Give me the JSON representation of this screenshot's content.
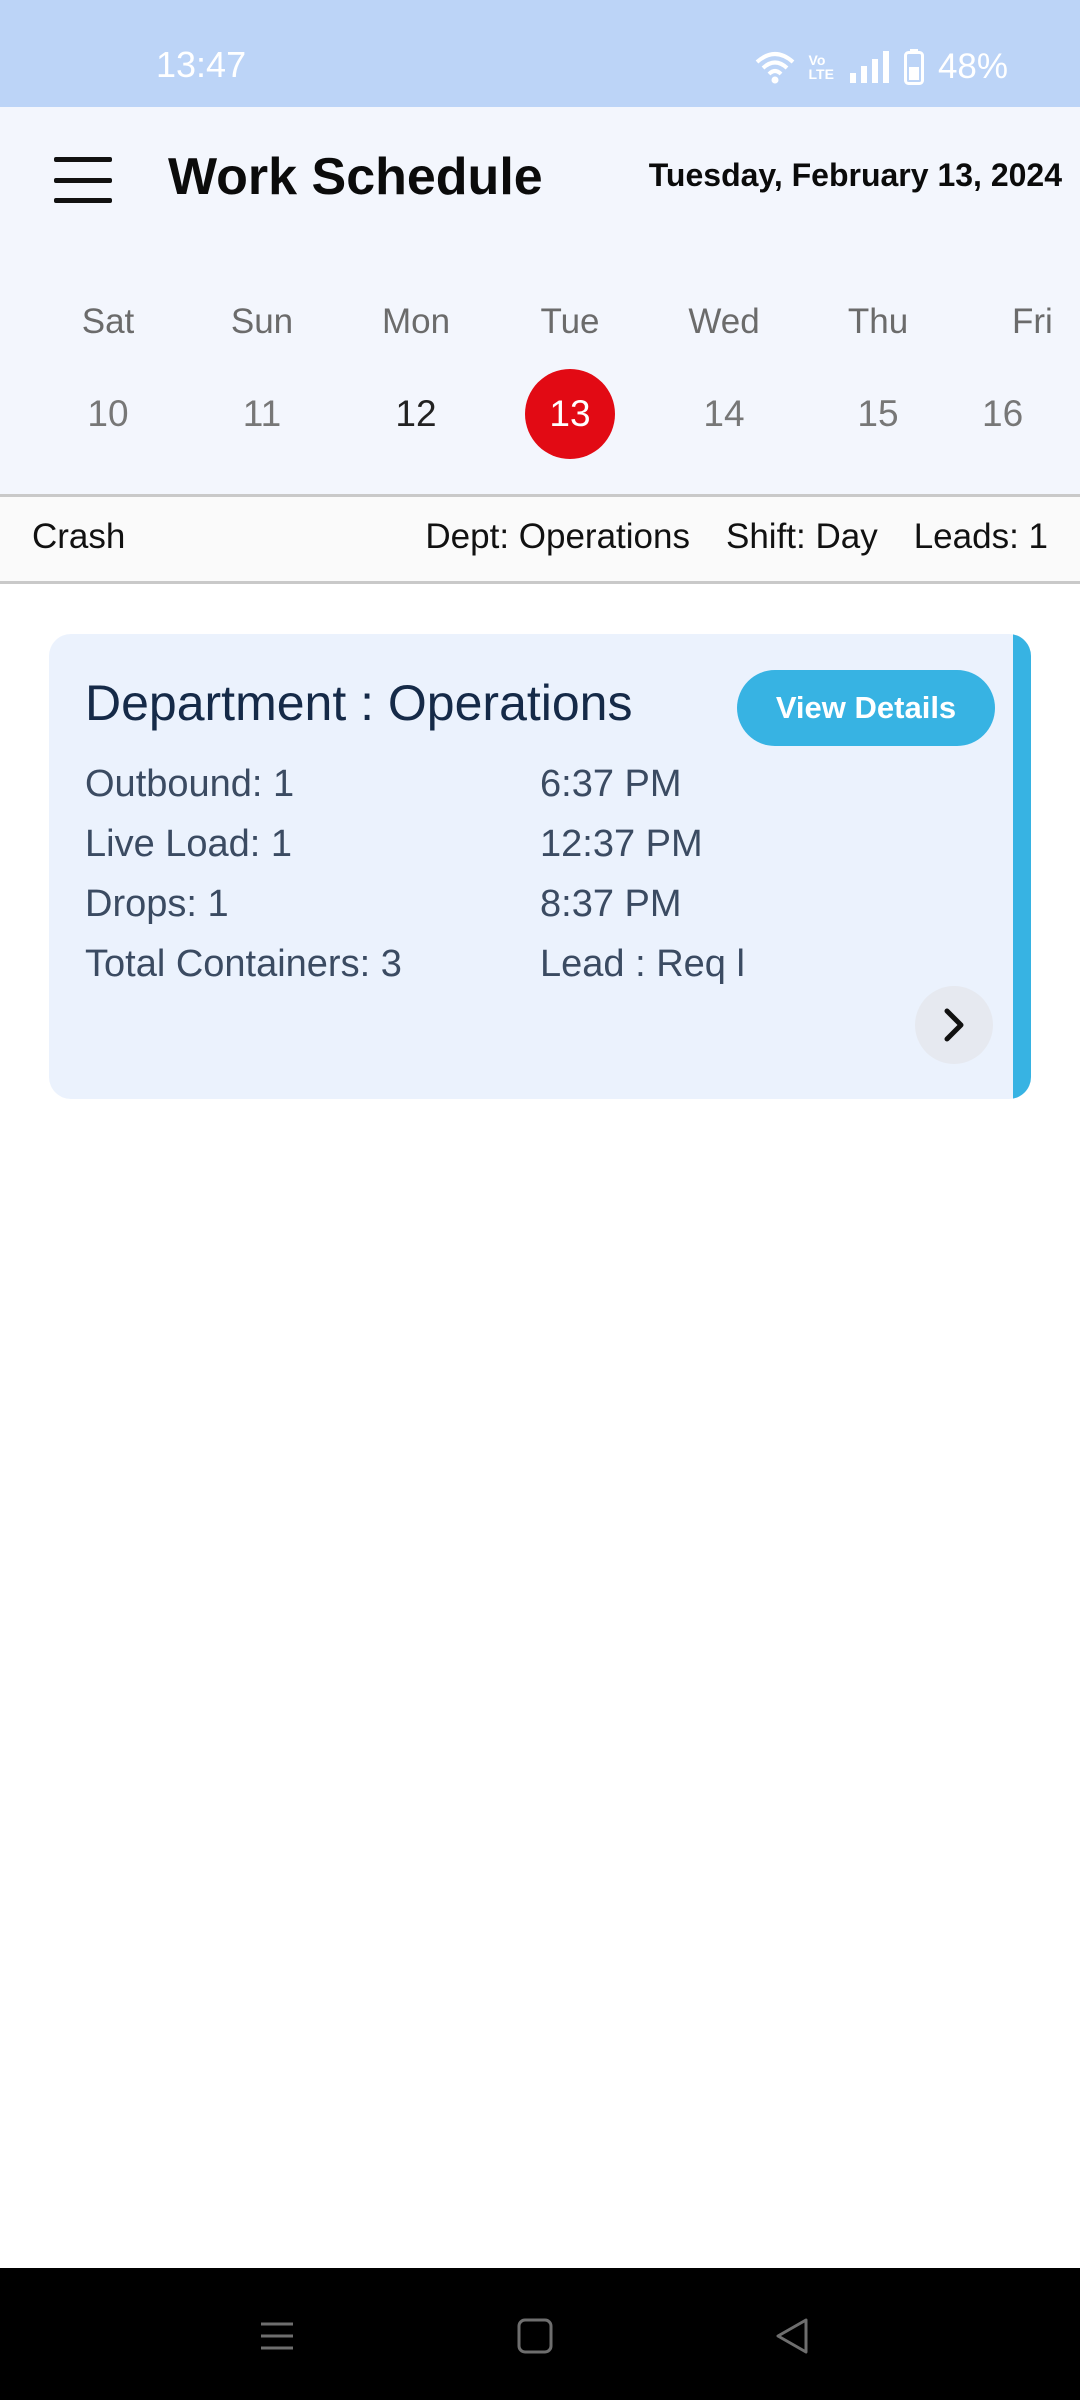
{
  "status_bar": {
    "time": "13:47",
    "battery": "48%",
    "network_badge_top": "Vo",
    "network_badge_bottom": "LTE",
    "icons": [
      "wifi-icon",
      "volte-icon",
      "signal-icon",
      "battery-icon"
    ]
  },
  "header": {
    "title": "Work Schedule",
    "date": "Tuesday, February 13, 2024",
    "menu_icon": "hamburger-icon"
  },
  "week": {
    "days": [
      {
        "name": "Sat",
        "num": "10"
      },
      {
        "name": "Sun",
        "num": "11"
      },
      {
        "name": "Mon",
        "num": "12"
      },
      {
        "name": "Tue",
        "num": "13"
      },
      {
        "name": "Wed",
        "num": "14"
      },
      {
        "name": "Thu",
        "num": "15"
      },
      {
        "name": "Fri",
        "num": "16"
      }
    ],
    "selected": "13",
    "selected_color": "#e20a14"
  },
  "info_bar": {
    "name": "Crash",
    "dept": "Dept: Operations",
    "shift": "Shift: Day",
    "leads": "Leads: 1"
  },
  "card": {
    "title": "Department : Operations",
    "view_details_label": "View Details",
    "accent_color": "#37b3e3",
    "rows": [
      {
        "left": "Outbound: 1",
        "right": "6:37 PM"
      },
      {
        "left": "Live Load: 1",
        "right": "12:37 PM"
      },
      {
        "left": "Drops: 1",
        "right": "8:37 PM"
      },
      {
        "left": "Total Containers: 3",
        "right": "Lead : Req  l"
      }
    ],
    "chevron_icon": "chevron-right-icon"
  },
  "nav_bar": {
    "icons": [
      "recents-icon",
      "home-icon",
      "back-icon"
    ]
  }
}
